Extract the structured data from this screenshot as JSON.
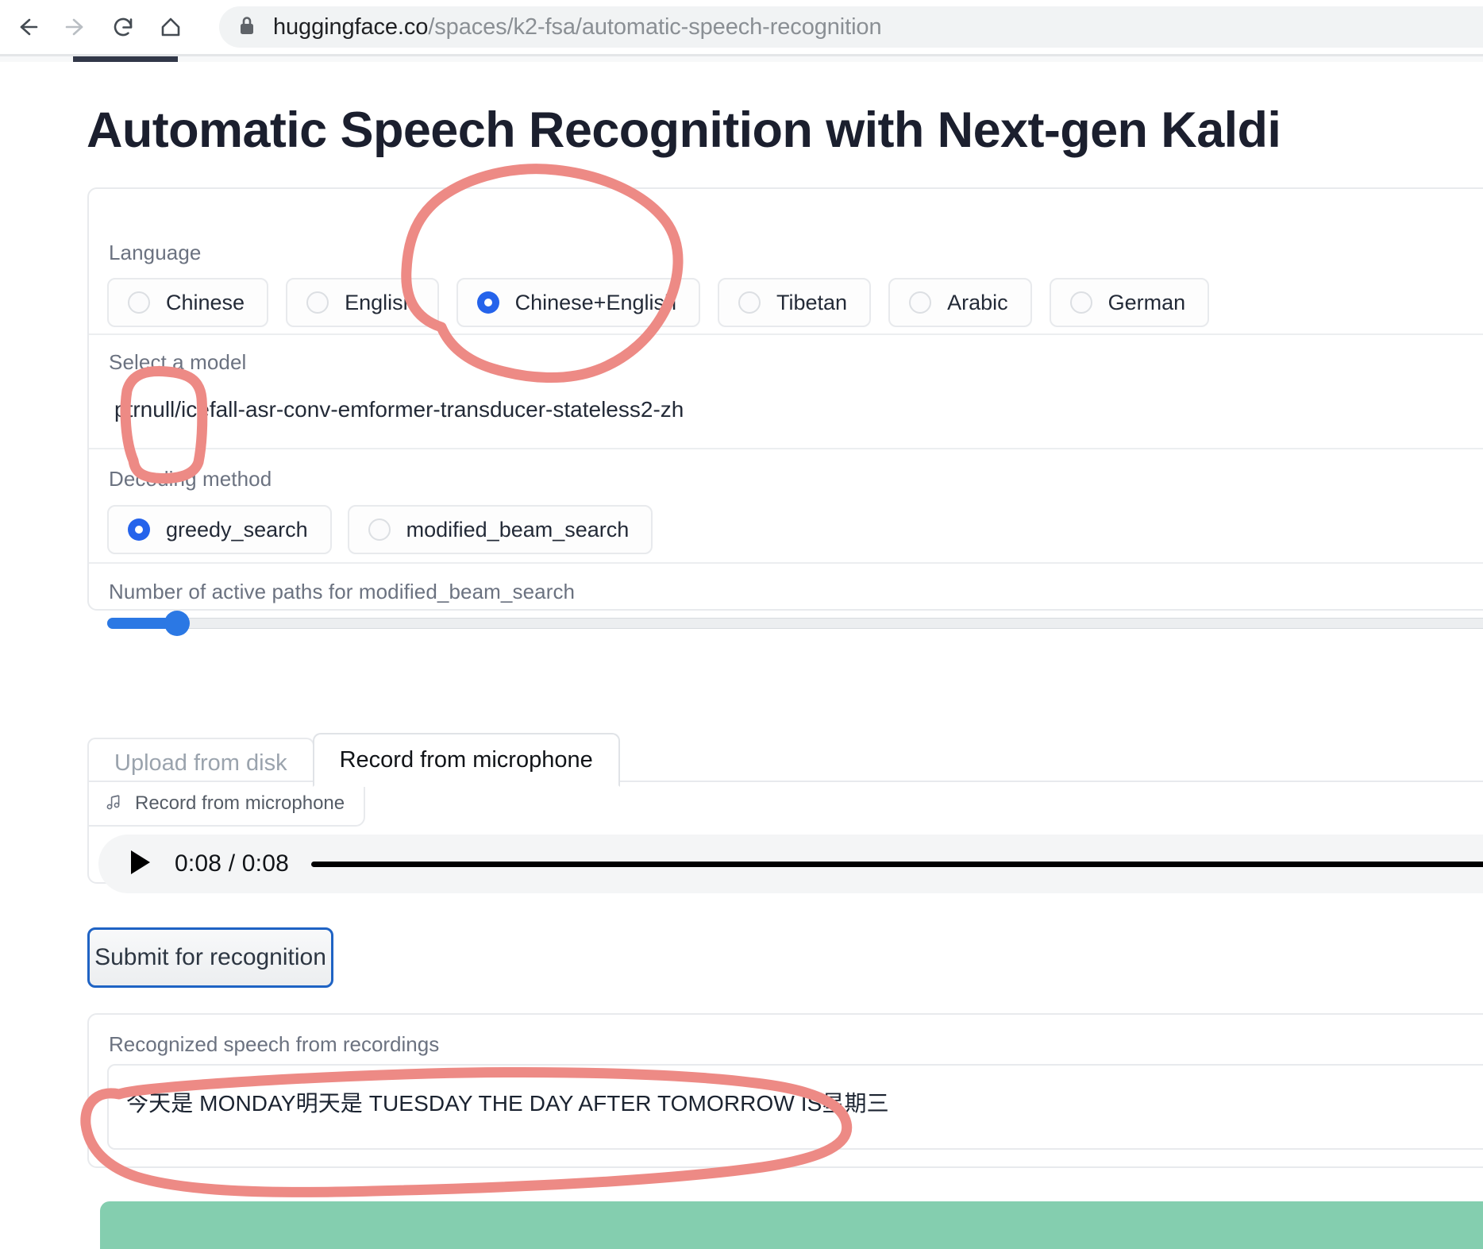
{
  "browser": {
    "back_icon": "arrow-left-icon",
    "forward_icon": "arrow-right-icon",
    "reload_icon": "reload-icon",
    "home_icon": "home-icon",
    "lock_icon": "lock-icon",
    "url_host": "huggingface.co",
    "url_path": "/spaces/k2-fsa/automatic-speech-recognition",
    "loading_bar_visible": true
  },
  "page": {
    "title": "Automatic Speech Recognition with Next-gen Kaldi"
  },
  "settings": {
    "language": {
      "label": "Language",
      "selected": "Chinese+English",
      "options": [
        {
          "label": "Chinese",
          "checked": false
        },
        {
          "label": "English",
          "checked": false
        },
        {
          "label": "Chinese+English",
          "checked": true
        },
        {
          "label": "Tibetan",
          "checked": false
        },
        {
          "label": "Arabic",
          "checked": false
        },
        {
          "label": "German",
          "checked": false
        }
      ]
    },
    "model": {
      "label": "Select a model",
      "value": "ptrnull/icefall-asr-conv-emformer-transducer-stateless2-zh"
    },
    "decoding": {
      "label": "Decoding method",
      "selected": "greedy_search",
      "options": [
        {
          "label": "greedy_search",
          "checked": true
        },
        {
          "label": "modified_beam_search",
          "checked": false
        }
      ]
    },
    "active_paths": {
      "label": "Number of active paths for modified_beam_search",
      "fill_percent": 4.7
    }
  },
  "input_tabs": {
    "items": [
      {
        "label": "Upload from disk",
        "active": false
      },
      {
        "label": "Record from microphone",
        "active": true
      }
    ]
  },
  "audio": {
    "chip_label": "Record from microphone",
    "chip_icon": "music-note-icon",
    "play_icon": "play-icon",
    "time": "0:08 / 0:08"
  },
  "submit": {
    "label": "Submit for recognition"
  },
  "output": {
    "label": "Recognized speech from recordings",
    "text": "今天是 MONDAY明天是 TUESDAY THE DAY AFTER TOMORROW IS星期三"
  },
  "colors": {
    "accent_blue": "#2563eb",
    "slider_blue": "#2b78e4",
    "annotation_pink": "#ed8a85",
    "green_panel": "#84ceaf",
    "title_dark": "#1b1f2e",
    "muted_text": "#6b7280"
  },
  "annotations": {
    "circle_language_option": "Chinese+English",
    "circle_model_prefix": "ptrnull/",
    "circle_output_row": "Recognized speech from recordings"
  }
}
